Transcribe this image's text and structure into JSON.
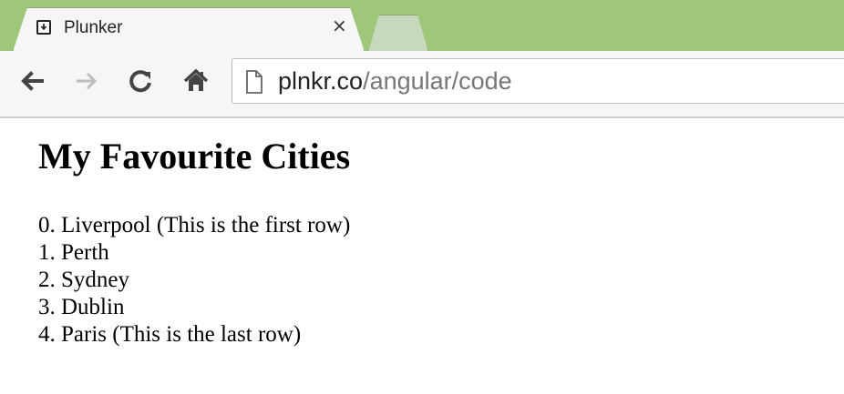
{
  "browser": {
    "tab_title": "Plunker",
    "tab_close": "×",
    "url_host": "plnkr.co",
    "url_path": "/angular/code",
    "colors": {
      "tabstrip": "#9ec77a",
      "toolbar": "#f6f6f6"
    },
    "icons": {
      "favicon": "download-box-icon",
      "back": "arrow-left-icon",
      "forward": "arrow-right-icon",
      "reload": "reload-icon",
      "home": "home-icon",
      "page": "page-icon"
    }
  },
  "page": {
    "title": "My Favourite Cities",
    "cities": [
      "0. Liverpool (This is the first row)",
      "1. Perth",
      "2. Sydney",
      "3. Dublin",
      "4. Paris (This is the last row)"
    ]
  }
}
